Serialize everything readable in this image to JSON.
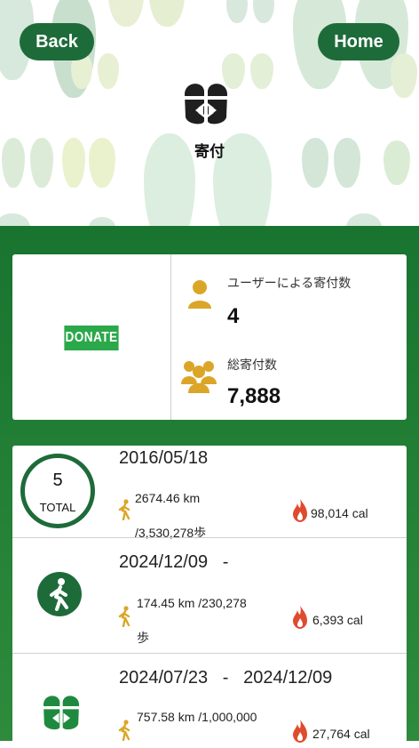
{
  "header": {
    "back_label": "Back",
    "home_label": "Home",
    "title": "寄付"
  },
  "summary": {
    "donate_label": "DONATE",
    "user_donations_label": "ユーザーによる寄付数",
    "user_donations_value": "4",
    "total_donations_label": "総寄付数",
    "total_donations_value": "7,888"
  },
  "records": [
    {
      "badge_number": "5",
      "badge_label": "TOTAL",
      "date": "2016/05/18",
      "distance_line1": "2674.46 km",
      "distance_line2": "/3,530,278歩",
      "calories": "98,014 cal"
    },
    {
      "date": "2024/12/09   -",
      "distance_line1": "174.45 km /230,278",
      "distance_line2": "歩",
      "calories": "6,393 cal"
    },
    {
      "date": "2024/07/23   -   2024/12/09",
      "distance_line1": "757.58 km /1,000,000",
      "calories": "27,764 cal"
    }
  ],
  "colors": {
    "brand_green": "#1e6b3a",
    "panel_green": "#18742f",
    "donate_green": "#2aa84a",
    "gold": "#dba628",
    "flame_red": "#e04b2f"
  },
  "icons": {
    "logo": "footprints-arrows-icon",
    "user": "user-icon",
    "group": "group-icon",
    "walker_small": "walking-person-icon",
    "walker_circle": "walking-person-circle-icon",
    "calorie": "flame-icon"
  }
}
